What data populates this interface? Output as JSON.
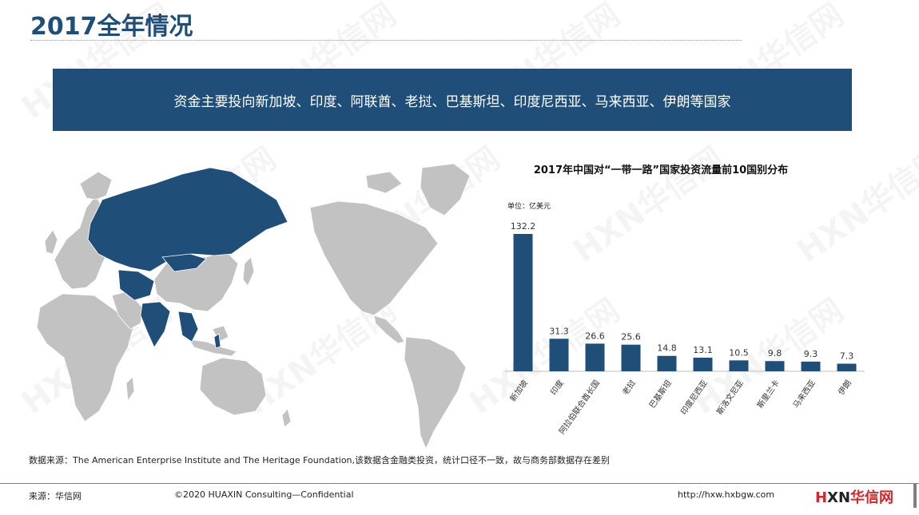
{
  "page": {
    "title": "2017全年情况",
    "banner": "资金主要投向新加坡、印度、阿联酋、老挝、巴基斯坦、印度尼西亚、马来西亚、伊朗等国家",
    "note": "数据来源：The American Enterprise Institute and The Heritage Foundation,该数据含金融类投资，统计口径不一致，故与商务部数据存在差别",
    "footer_source": "来源：华信网",
    "footer_copyright": "©2020 HUAXIN Consulting—Confidential",
    "footer_url": "http://hxw.hxbgw.com",
    "logo_h": "H",
    "logo_xn": "XN",
    "logo_cn": "华信网",
    "watermark": "HXN华信网"
  },
  "colors": {
    "bar": "#1f4e79",
    "highlight_country": "#1f4e79",
    "land": "#c2c2c2",
    "logo_red": "#d6252b"
  },
  "chart_data": {
    "type": "bar",
    "title": "2017年中国对“一带一路”国家投资流量前10国别分布",
    "unit": "单位：亿美元",
    "categories": [
      "新加坡",
      "印度",
      "阿拉伯联合酋长国",
      "老挝",
      "巴基斯坦",
      "印度尼西亚",
      "斯洛文尼亚",
      "斯里兰卡",
      "马来西亚",
      "伊朗"
    ],
    "values": [
      132.2,
      31.3,
      26.6,
      25.6,
      14.8,
      13.1,
      10.5,
      9.8,
      9.3,
      7.3
    ],
    "ylim": [
      0,
      132.2
    ],
    "grid": false,
    "legend": "none"
  }
}
